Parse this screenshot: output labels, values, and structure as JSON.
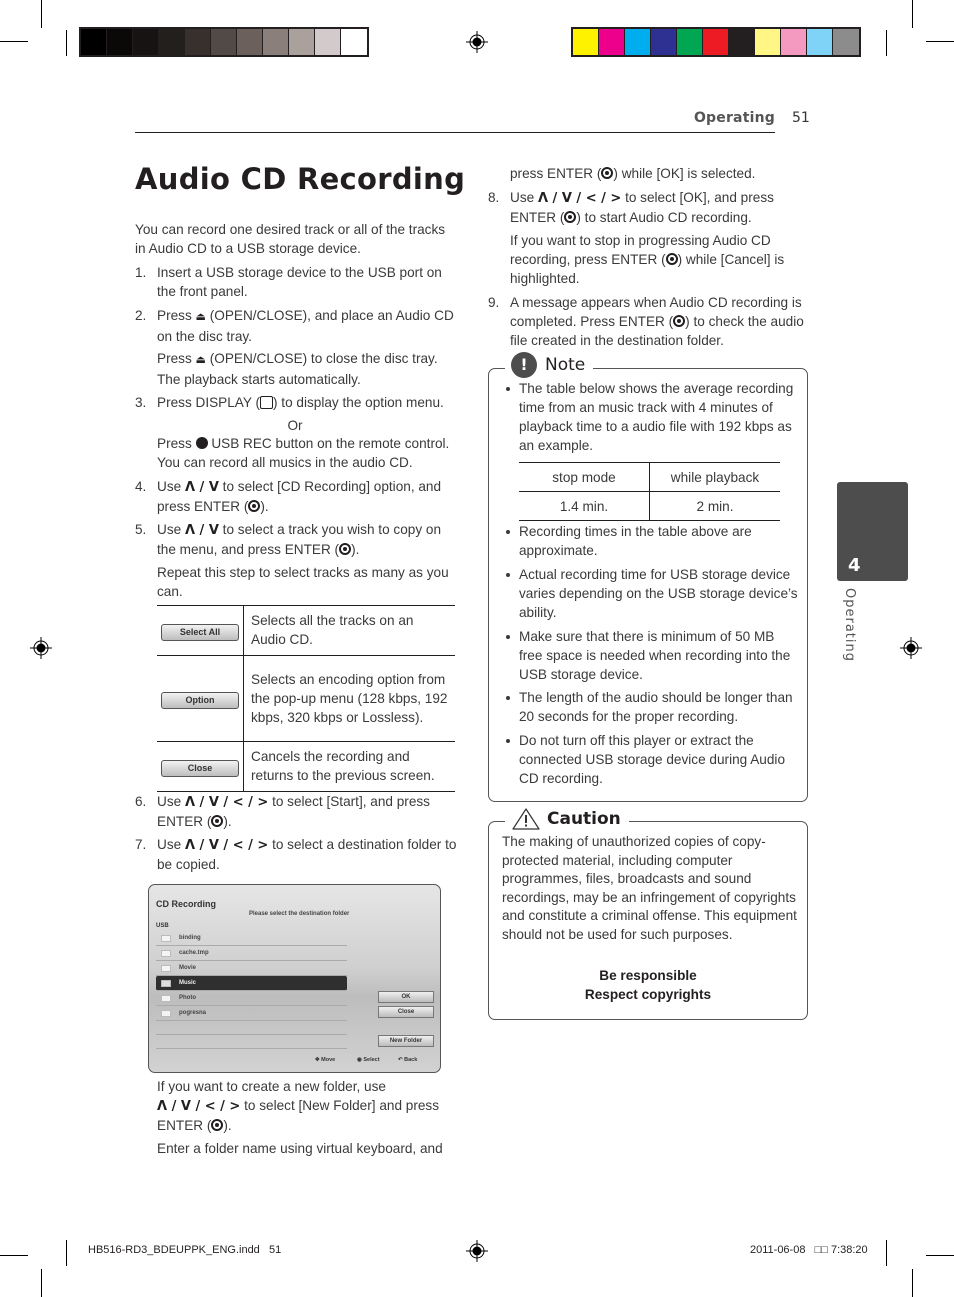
{
  "print_marks": {
    "grayscale_swatches": [
      "#000000",
      "#0b0907",
      "#171312",
      "#221f1c",
      "#38302d",
      "#524a46",
      "#6b605c",
      "#8a7f7a",
      "#aaa09c",
      "#d3cbcb",
      "#ffffff"
    ],
    "color_swatches": [
      "#fff200",
      "#ec008c",
      "#00aeef",
      "#2e3192",
      "#00a651",
      "#ed1c24",
      "#231f20",
      "#fff685",
      "#f49ac1",
      "#7fd3f7",
      "#8c8c8c"
    ]
  },
  "header": {
    "section": "Operating",
    "page_number": "51"
  },
  "side_tab": {
    "chapter_number": "4",
    "label": "Operating"
  },
  "title": "Audio CD Recording",
  "intro": "You can record one desired track or all of the tracks in Audio CD to a USB storage device.",
  "steps": {
    "s1": {
      "num": "1.",
      "text": "Insert a USB storage device to the USB port on the front panel."
    },
    "s2": {
      "num": "2.",
      "pre": "Press",
      "post": "(OPEN/CLOSE), and place an Audio CD on the disc tray.",
      "sub_pre": "Press",
      "sub_post": "(OPEN/CLOSE) to close the disc tray. The playback starts automatically."
    },
    "s3": {
      "num": "3.",
      "pre": "Press DISPLAY (",
      "post": ") to display the option menu.",
      "or": "Or",
      "alt_pre": "Press",
      "alt_post": "USB REC button on the remote control. You can record all musics in the audio CD."
    },
    "s4": {
      "num": "4.",
      "pre": "Use",
      "arrows": "Λ / V",
      "post": "to select [CD Recording] option, and press ENTER (",
      "end": ")."
    },
    "s5": {
      "num": "5.",
      "pre": "Use",
      "arrows": "Λ / V",
      "post": "to select a track you wish to copy on the menu, and press ENTER (",
      "end": ").",
      "sub": "Repeat this step to select tracks as many as you can."
    },
    "s6": {
      "num": "6.",
      "pre": "Use",
      "arrows": "Λ / V / < / >",
      "post": "to select [Start], and press ENTER (",
      "end": ")."
    },
    "s7": {
      "num": "7.",
      "pre": "Use",
      "arrows": "Λ / V / < / >",
      "post": "to select a destination folder to be copied.",
      "sub1_pre": "If you want to create a new folder, use",
      "sub1_arrows": "Λ / V / < / >",
      "sub1_post": "to select [New Folder] and press ENTER (",
      "sub1_end": ").",
      "sub2": "Enter a folder name using virtual keyboard, and",
      "sub2_cont_pre": "press ENTER (",
      "sub2_cont_post": ") while [OK] is selected."
    },
    "s8": {
      "num": "8.",
      "pre": "Use",
      "arrows": "Λ / V / < / >",
      "post": "to select [OK], and press ENTER (",
      "end": ") to start Audio CD recording.",
      "sub_pre": "If you want to stop in progressing Audio CD recording, press ENTER (",
      "sub_post": ") while [Cancel] is highlighted."
    },
    "s9": {
      "num": "9.",
      "pre": "A message appears when Audio CD recording is completed. Press ENTER (",
      "post": ") to check the audio file created in the destination folder."
    }
  },
  "button_table": [
    {
      "button": "Select All",
      "desc": "Selects all the tracks on an Audio CD."
    },
    {
      "button": "Option",
      "desc": "Selects an encoding option from the pop-up menu (128 kbps, 192 kbps, 320 kbps or Lossless)."
    },
    {
      "button": "Close",
      "desc": "Cancels the recording and returns to the previous screen."
    }
  ],
  "screenshot": {
    "title": "CD Recording",
    "subtitle": "Please select the destination folder",
    "device": "USB",
    "folders": [
      "binding",
      "cache.tmp",
      "Movie",
      "Music",
      "Photo",
      "pogresna"
    ],
    "selected_folder": "Music",
    "buttons": {
      "ok": "OK",
      "close": "Close",
      "new_folder": "New Folder"
    },
    "footer": {
      "move": "Move",
      "select": "Select",
      "back": "Back"
    }
  },
  "note": {
    "title": "Note",
    "bullets": [
      "The table below shows the average recording time from an music track with 4 minutes of playback time to a audio file with 192 kbps as an example.",
      "Recording times in the table above are approximate.",
      "Actual recording time for USB storage device varies depending on the USB storage device’s ability.",
      "Make sure that there is minimum of 50 MB free space is needed when recording into the USB storage device.",
      "The length of the audio should be longer than 20 seconds for the proper recording.",
      "Do not turn off this player or extract the connected USB storage device during Audio CD recording."
    ],
    "table": {
      "headers": [
        "stop mode",
        "while playback"
      ],
      "values": [
        "1.4 min.",
        "2 min."
      ]
    }
  },
  "caution": {
    "title": "Caution",
    "text": "The making of unauthorized copies of copy-protected material, including computer programmes, files, broadcasts and sound recordings, may be an infringement of copyrights and constitute a criminal offense. This equipment should not be used for such purposes.",
    "bold_line1": "Be responsible",
    "bold_line2": "Respect copyrights"
  },
  "footer": {
    "file": "HB516-RD3_BDEUPPK_ENG.indd   51",
    "datetime": "2011-06-08   □□ 7:38:20"
  }
}
